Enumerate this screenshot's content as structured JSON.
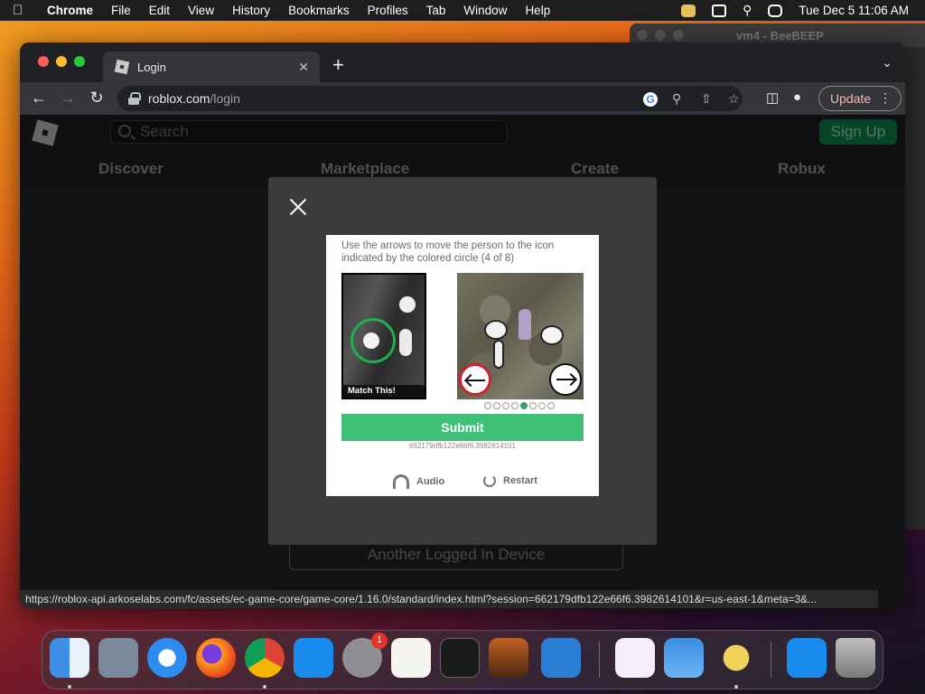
{
  "menubar": {
    "app": "Chrome",
    "items": [
      "File",
      "Edit",
      "View",
      "History",
      "Bookmarks",
      "Profiles",
      "Tab",
      "Window",
      "Help"
    ],
    "datetime": "Tue Dec 5  11:06 AM"
  },
  "background_window": {
    "title": "vm4 - BeeBEEP"
  },
  "browser": {
    "tab_title": "Login",
    "url_host": "roblox.com",
    "url_path": "/login",
    "update_label": "Update"
  },
  "roblox": {
    "search_placeholder": "Search",
    "signup_label": "Sign Up",
    "nav": [
      "Discover",
      "Marketplace",
      "Create",
      "Robux"
    ],
    "another_device_label": "Another Logged In Device"
  },
  "captcha": {
    "instruction": "Use the arrows to move the person to the icon indicated by the colored circle (4 of 8)",
    "match_label": "Match This!",
    "submit_label": "Submit",
    "session_id": "662179dfb122e66f6.3982614101",
    "audio_label": "Audio",
    "restart_label": "Restart",
    "pager_total": 8,
    "pager_active": 5
  },
  "status_url": "https://roblox-api.arkoselabs.com/fc/assets/ec-game-core/game-core/1.16.0/standard/index.html?session=662179dfb122e66f6.3982614101&r=us-east-1&meta=3&...",
  "dock": {
    "apps": [
      "finder",
      "launchpad",
      "safari",
      "firefox",
      "chrome",
      "app-store",
      "system-settings",
      "textedit",
      "terminal",
      "garageband",
      "vscode",
      "visual-studio",
      "weather",
      "beebeep",
      "app-store-2",
      "trash"
    ],
    "settings_badge": "1"
  }
}
